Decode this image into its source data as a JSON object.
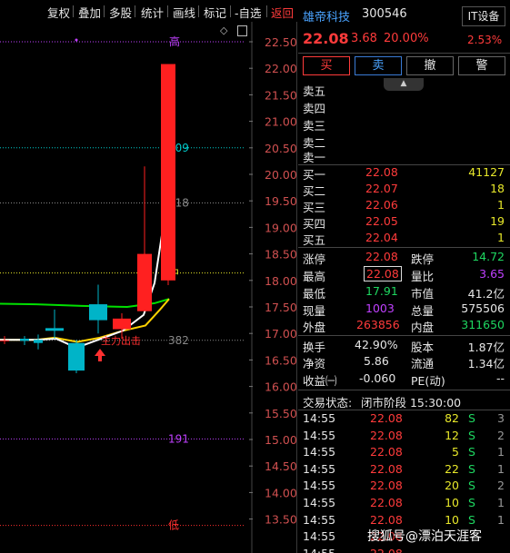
{
  "toolbar": {
    "items": [
      "复权",
      "叠加",
      "多股",
      "统计",
      "画线",
      "标记",
      "-自选",
      "返回"
    ]
  },
  "chart": {
    "price_ticks": [
      "22.50",
      "22.00",
      "21.50",
      "21.00",
      "20.50",
      "20.00",
      "19.50",
      "19.00",
      "18.50",
      "18.00",
      "17.50",
      "17.00",
      "16.50",
      "16.00",
      "15.50",
      "15.00",
      "14.50",
      "14.00",
      "13.50"
    ],
    "level_labels": {
      "top_marker": "高",
      "l809": "809",
      "l618": "618",
      "mid": "中",
      "l382": "382",
      "l191": "191",
      "low": "低"
    },
    "annotation_text": "主力出击",
    "colors": {
      "up": "#ff2020",
      "down": "#00b4c8",
      "ma_white": "#ffffff",
      "ma_yellow": "#ffd200",
      "ma_green": "#00e000",
      "fib_cyan": "#00cccc",
      "fib_yellow": "#e8e82a",
      "fib_purple": "#c040ff",
      "fib_red": "#ff3030"
    },
    "candles": [
      {
        "o": 16.87,
        "h": 16.95,
        "l": 16.8,
        "c": 16.87
      },
      {
        "o": 16.9,
        "h": 16.95,
        "l": 16.78,
        "c": 16.86
      },
      {
        "o": 16.88,
        "h": 16.98,
        "l": 16.7,
        "c": 16.82
      },
      {
        "o": 17.1,
        "h": 17.45,
        "l": 16.9,
        "c": 17.05
      },
      {
        "o": 16.82,
        "h": 16.88,
        "l": 16.25,
        "c": 16.3
      },
      {
        "o": 17.55,
        "h": 17.92,
        "l": 17.0,
        "c": 17.25
      },
      {
        "o": 17.08,
        "h": 17.38,
        "l": 16.9,
        "c": 17.28
      },
      {
        "o": 17.42,
        "h": 20.15,
        "l": 17.42,
        "c": 18.5
      },
      {
        "o": 18.0,
        "h": 22.08,
        "l": 17.91,
        "c": 22.08
      }
    ]
  },
  "quote": {
    "name": "雄帝科技",
    "code": "300546",
    "sector": "IT设备",
    "price": "22.08",
    "change": "3.68",
    "change_pct": "20.00%",
    "sector_pct": "2.53%"
  },
  "actions": [
    "买",
    "卖",
    "撤",
    "警"
  ],
  "order_book": {
    "asks": [
      {
        "label": "卖五",
        "price": "",
        "vol": ""
      },
      {
        "label": "卖四",
        "price": "",
        "vol": ""
      },
      {
        "label": "卖三",
        "price": "",
        "vol": ""
      },
      {
        "label": "卖二",
        "price": "",
        "vol": ""
      },
      {
        "label": "卖一",
        "price": "",
        "vol": ""
      }
    ],
    "bids": [
      {
        "label": "买一",
        "price": "22.08",
        "vol": "41127"
      },
      {
        "label": "买二",
        "price": "22.07",
        "vol": "18"
      },
      {
        "label": "买三",
        "price": "22.06",
        "vol": "1"
      },
      {
        "label": "买四",
        "price": "22.05",
        "vol": "19"
      },
      {
        "label": "买五",
        "price": "22.04",
        "vol": "1"
      }
    ]
  },
  "stats": {
    "limit_up_label": "涨停",
    "limit_up": "22.08",
    "limit_down_label": "跌停",
    "limit_down": "14.72",
    "high_label": "最高",
    "high": "22.08",
    "vol_ratio_label": "量比",
    "vol_ratio": "3.65",
    "low_label": "最低",
    "low": "17.91",
    "mcap_label": "市值",
    "mcap": "41.2亿",
    "cur_vol_label": "现量",
    "cur_vol": "1003",
    "total_vol_label": "总量",
    "total_vol": "575506",
    "outer_label": "外盘",
    "outer": "263856",
    "inner_label": "内盘",
    "inner": "311650",
    "turnover_label": "换手",
    "turnover": "42.90%",
    "equity_label": "股本",
    "equity": "1.87亿",
    "nav_label": "净资",
    "nav": "5.86",
    "float_label": "流通",
    "float": "1.34亿",
    "eps_label": "收益㈠",
    "eps": "-0.060",
    "pe_label": "PE(动)",
    "pe": "--"
  },
  "status": {
    "label": "交易状态:",
    "value": "闭市阶段 15:30:00"
  },
  "ticks": [
    {
      "time": "14:55",
      "price": "22.08",
      "vol": "82",
      "side": "S",
      "count": "3"
    },
    {
      "time": "14:55",
      "price": "22.08",
      "vol": "12",
      "side": "S",
      "count": "2"
    },
    {
      "time": "14:55",
      "price": "22.08",
      "vol": "5",
      "side": "S",
      "count": "1"
    },
    {
      "time": "14:55",
      "price": "22.08",
      "vol": "22",
      "side": "S",
      "count": "1"
    },
    {
      "time": "14:55",
      "price": "22.08",
      "vol": "20",
      "side": "S",
      "count": "2"
    },
    {
      "time": "14:55",
      "price": "22.08",
      "vol": "10",
      "side": "S",
      "count": "1"
    },
    {
      "time": "14:55",
      "price": "22.08",
      "vol": "10",
      "side": "S",
      "count": "1"
    },
    {
      "time": "14:55",
      "price": "22.08",
      "vol": "",
      "side": "",
      "count": ""
    },
    {
      "time": "14:55",
      "price": "22.08",
      "vol": "",
      "side": "",
      "count": ""
    }
  ],
  "watermark": "搜狐号@漂泊天涯客"
}
